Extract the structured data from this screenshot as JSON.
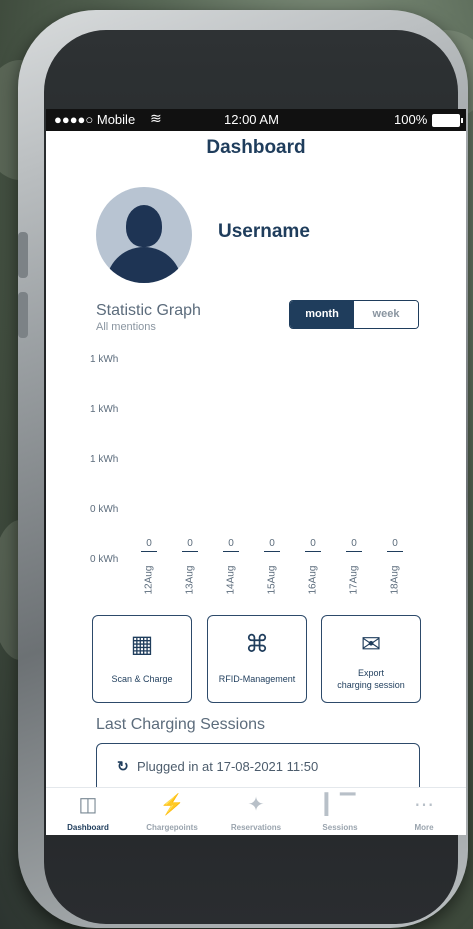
{
  "status_bar": {
    "carrier": "●●●●○ Mobile",
    "wifi_icon": "wifi-icon",
    "time": "12:00 AM",
    "battery": "100%"
  },
  "header": {
    "title": "Dashboard"
  },
  "profile": {
    "username": "Username"
  },
  "stats": {
    "title": "Statistic Graph",
    "subtitle": "All mentions",
    "toggle": {
      "active": "month",
      "inactive": "week"
    }
  },
  "chart_data": {
    "type": "bar",
    "categories": [
      "12Aug",
      "13Aug",
      "14Aug",
      "15Aug",
      "16Aug",
      "17Aug",
      "18Aug"
    ],
    "values": [
      0,
      0,
      0,
      0,
      0,
      0,
      0
    ],
    "y_tick_labels": [
      "1 kWh",
      "1 kWh",
      "1 kWh",
      "0 kWh",
      "0 kWh"
    ],
    "value_labels": [
      "0",
      "0",
      "0",
      "0",
      "0",
      "0",
      "0"
    ]
  },
  "actions": [
    {
      "label": "Scan & Charge",
      "icon": "qr-code-icon"
    },
    {
      "label": "RFID-Management",
      "icon": "rfid-signal-icon"
    },
    {
      "label_line1": "Export",
      "label_line2": "charging session",
      "icon": "envelope-icon"
    }
  ],
  "sessions": {
    "title": "Last Charging Sessions",
    "items": [
      {
        "text": "Plugged in at  17-08-2021 11:50",
        "icon": "refresh-icon"
      }
    ]
  },
  "tabbar": [
    {
      "label": "Dashboard",
      "icon": "dashboard-icon",
      "active": true
    },
    {
      "label": "Chargepoints",
      "icon": "lightning-icon",
      "active": false
    },
    {
      "label": "Reservations",
      "icon": "pin-icon",
      "active": false
    },
    {
      "label": "Sessions",
      "icon": "bar-chart-icon",
      "active": false
    },
    {
      "label": "More",
      "icon": "more-icon",
      "active": false
    }
  ]
}
